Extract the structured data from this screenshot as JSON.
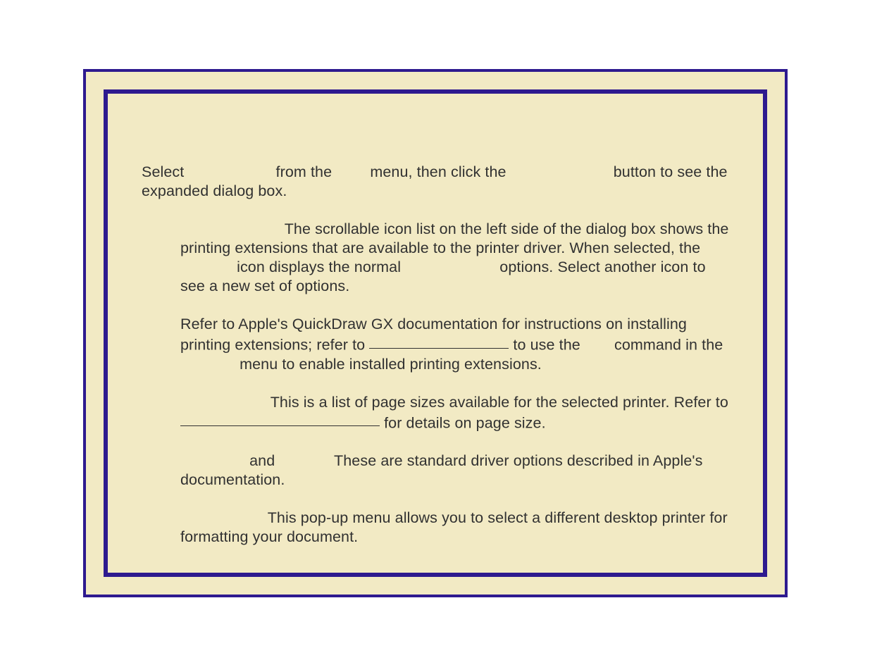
{
  "p1_a": "Select",
  "p1_b": "from the",
  "p1_c": "menu, then click the",
  "p1_d": "button to see the expanded dialog box.",
  "p2_a": "The scrollable icon list on the left side of the dialog box shows the printing extensions that are available to the printer driver.  When selected, the",
  "p2_b": "icon displays the normal",
  "p2_c": "options.  Select another icon to see a new set of options.",
  "p3_a": "Refer to Apple's QuickDraw GX documentation for instructions on installing printing extensions; refer to ",
  "p3_b": " to use the ",
  "p3_c": "command in the",
  "p3_d": "menu to enable installed printing extensions.",
  "p4_a": "This is a list of page sizes available for the selected printer.  Refer to ",
  "p4_b": " for details on page size.",
  "p5_a": "and",
  "p5_b": "These are standard driver options described in Apple's documentation.",
  "p6": "This pop-up menu allows you to select a different desktop printer for formatting your document."
}
